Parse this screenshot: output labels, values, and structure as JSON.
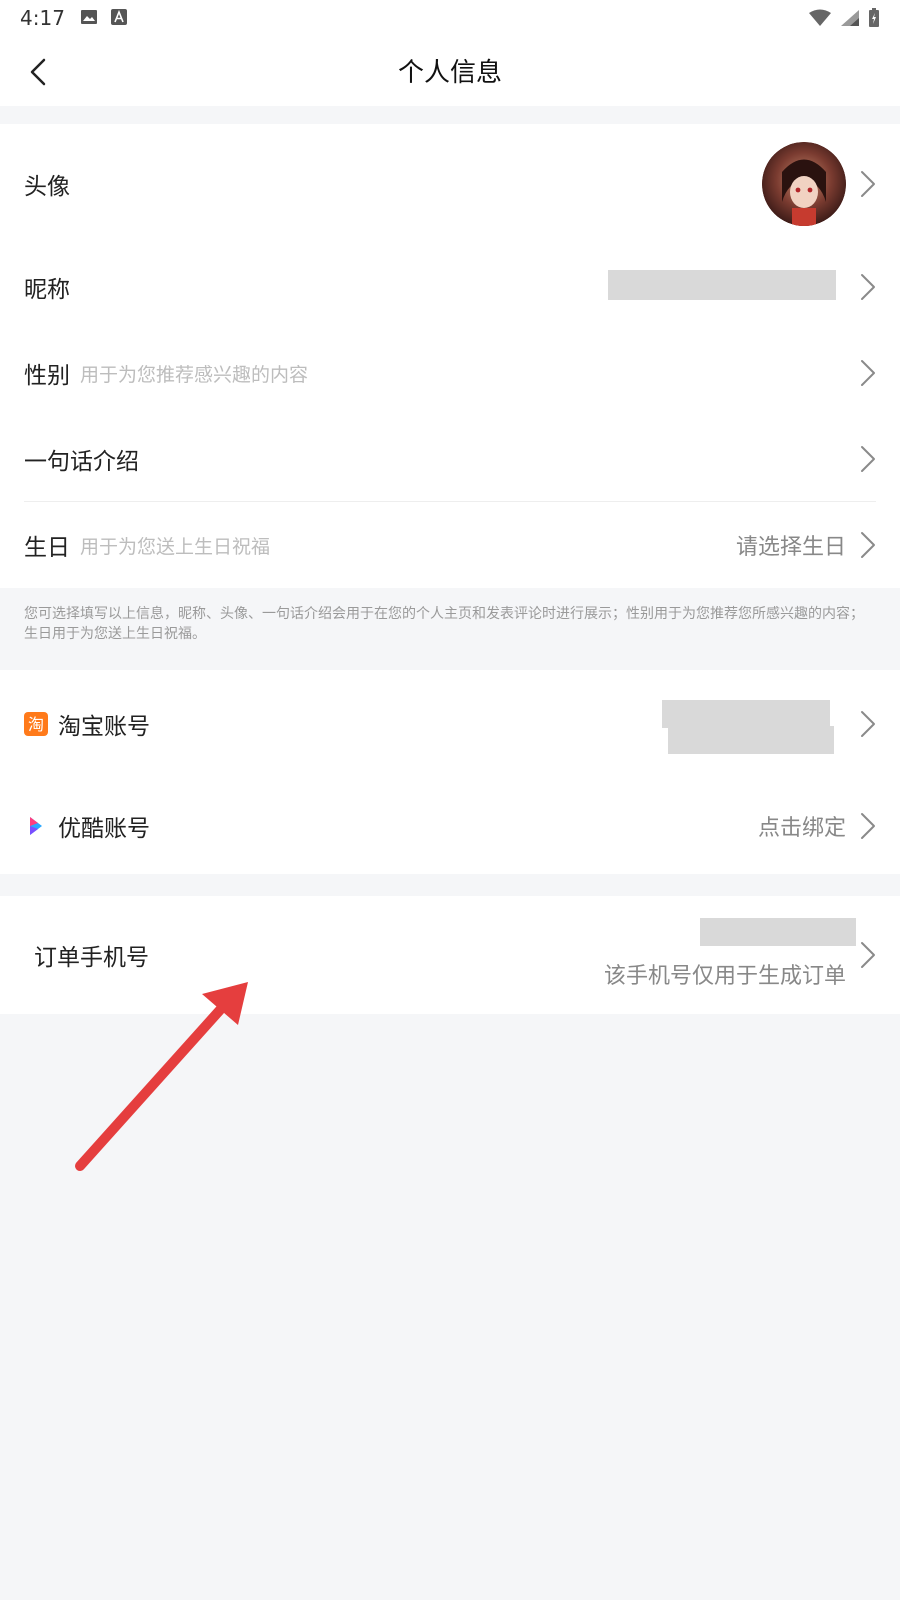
{
  "status_bar": {
    "time": "4:17"
  },
  "header": {
    "title": "个人信息"
  },
  "profile": {
    "avatar_label": "头像",
    "nickname_label": "昵称",
    "gender_label": "性别",
    "gender_hint": "用于为您推荐感兴趣的内容",
    "intro_label": "一句话介绍",
    "birthday_label": "生日",
    "birthday_hint": "用于为您送上生日祝福",
    "birthday_value": "请选择生日"
  },
  "note": "您可选择填写以上信息，昵称、头像、一句话介绍会用于在您的个人主页和发表评论时进行展示；性别用于为您推荐您所感兴趣的内容；生日用于为您送上生日祝福。",
  "accounts": {
    "taobao_label": "淘宝账号",
    "youku_label": "优酷账号",
    "youku_value": "点击绑定"
  },
  "order_phone": {
    "label": "订单手机号",
    "hint": "该手机号仅用于生成订单"
  },
  "colors": {
    "annotation_arrow": "#e53e3e",
    "taobao_orange": "#ff7a1a",
    "youku_blue": "#2aa7ff",
    "youku_pink": "#ff3d7f"
  },
  "icons": [
    "back-icon",
    "chevron-right-icon",
    "taobao-icon",
    "youku-icon",
    "wifi-icon",
    "signal-icon",
    "battery-icon",
    "image-icon",
    "text-icon"
  ]
}
